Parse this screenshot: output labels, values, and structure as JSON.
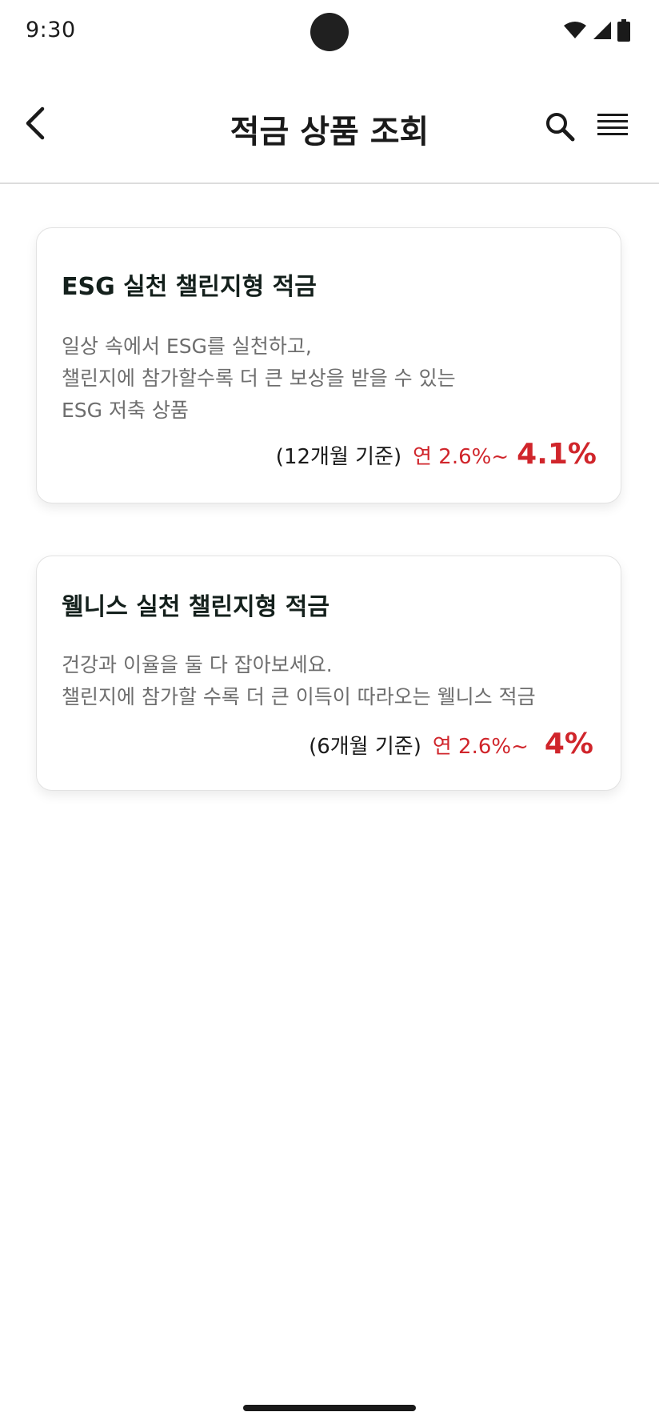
{
  "status_bar": {
    "time": "9:30"
  },
  "header": {
    "title": "적금 상품 조회",
    "icons": {
      "back": "chevron-left-icon",
      "search": "search-icon",
      "menu": "menu-icon"
    }
  },
  "products": [
    {
      "title": "ESG 실천 챌린지형 적금",
      "description": [
        "일상 속에서 ESG를 실천하고,",
        "챌린지에 참가할수록 더 큰 보상을 받을 수 있는",
        "ESG 저축 상품"
      ],
      "period": "(12개월 기준)",
      "rate_min": "연 2.6%~",
      "rate_max": "4.1%"
    },
    {
      "title": "웰니스 실천 챌린지형 적금",
      "description": [
        "건강과 이율을 둘 다 잡아보세요.",
        "챌린지에 참가할 수록 더 큰 이득이 따라오는 웰니스 적금"
      ],
      "period": "(6개월 기준)",
      "rate_min": "연 2.6%~",
      "rate_max": "4%"
    }
  ],
  "colors": {
    "accent_red": "#d0252b",
    "title_dark": "#14201c",
    "description_gray": "#6e6e6e",
    "divider": "#dcdcdc"
  }
}
